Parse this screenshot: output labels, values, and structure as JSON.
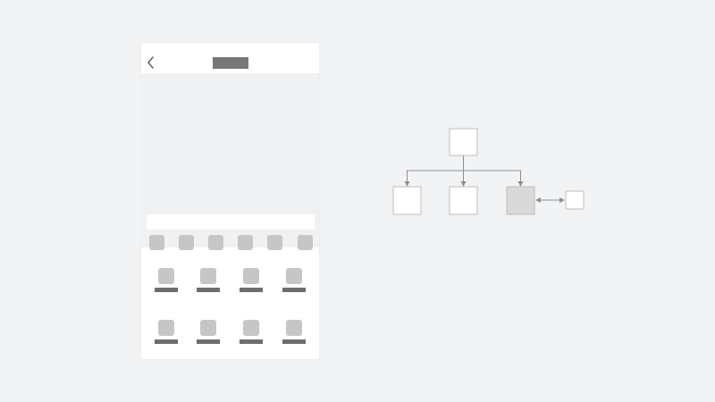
{
  "colors": {
    "page_background": "#f2f3f5",
    "panel": "#ffffff",
    "hero_fill": "#f0f1f3",
    "placeholder_dark": "#777777",
    "placeholder_mid": "#c6c6c6",
    "placeholder_dark_bar": "#6e6e6e",
    "connector": "#8f8f8f",
    "node_border": "#bdbdbd",
    "node_selected_fill": "#d9d9d9",
    "back_icon": "#666666"
  },
  "phone": {
    "nav": {
      "back_icon": "chevron-left-icon"
    },
    "chip_count": 6,
    "grid": {
      "rows": 2,
      "columns": 4
    }
  },
  "diagram": {
    "nodes": [
      {
        "id": "root",
        "selected": false
      },
      {
        "id": "child-1",
        "selected": false
      },
      {
        "id": "child-2",
        "selected": false
      },
      {
        "id": "child-3",
        "selected": true
      },
      {
        "id": "side",
        "selected": false
      }
    ],
    "edges": [
      {
        "from": "root",
        "to": "child-1",
        "style": "arrow"
      },
      {
        "from": "root",
        "to": "child-2",
        "style": "arrow"
      },
      {
        "from": "root",
        "to": "child-3",
        "style": "arrow"
      },
      {
        "from": "child-3",
        "to": "side",
        "style": "double-arrow"
      }
    ]
  }
}
